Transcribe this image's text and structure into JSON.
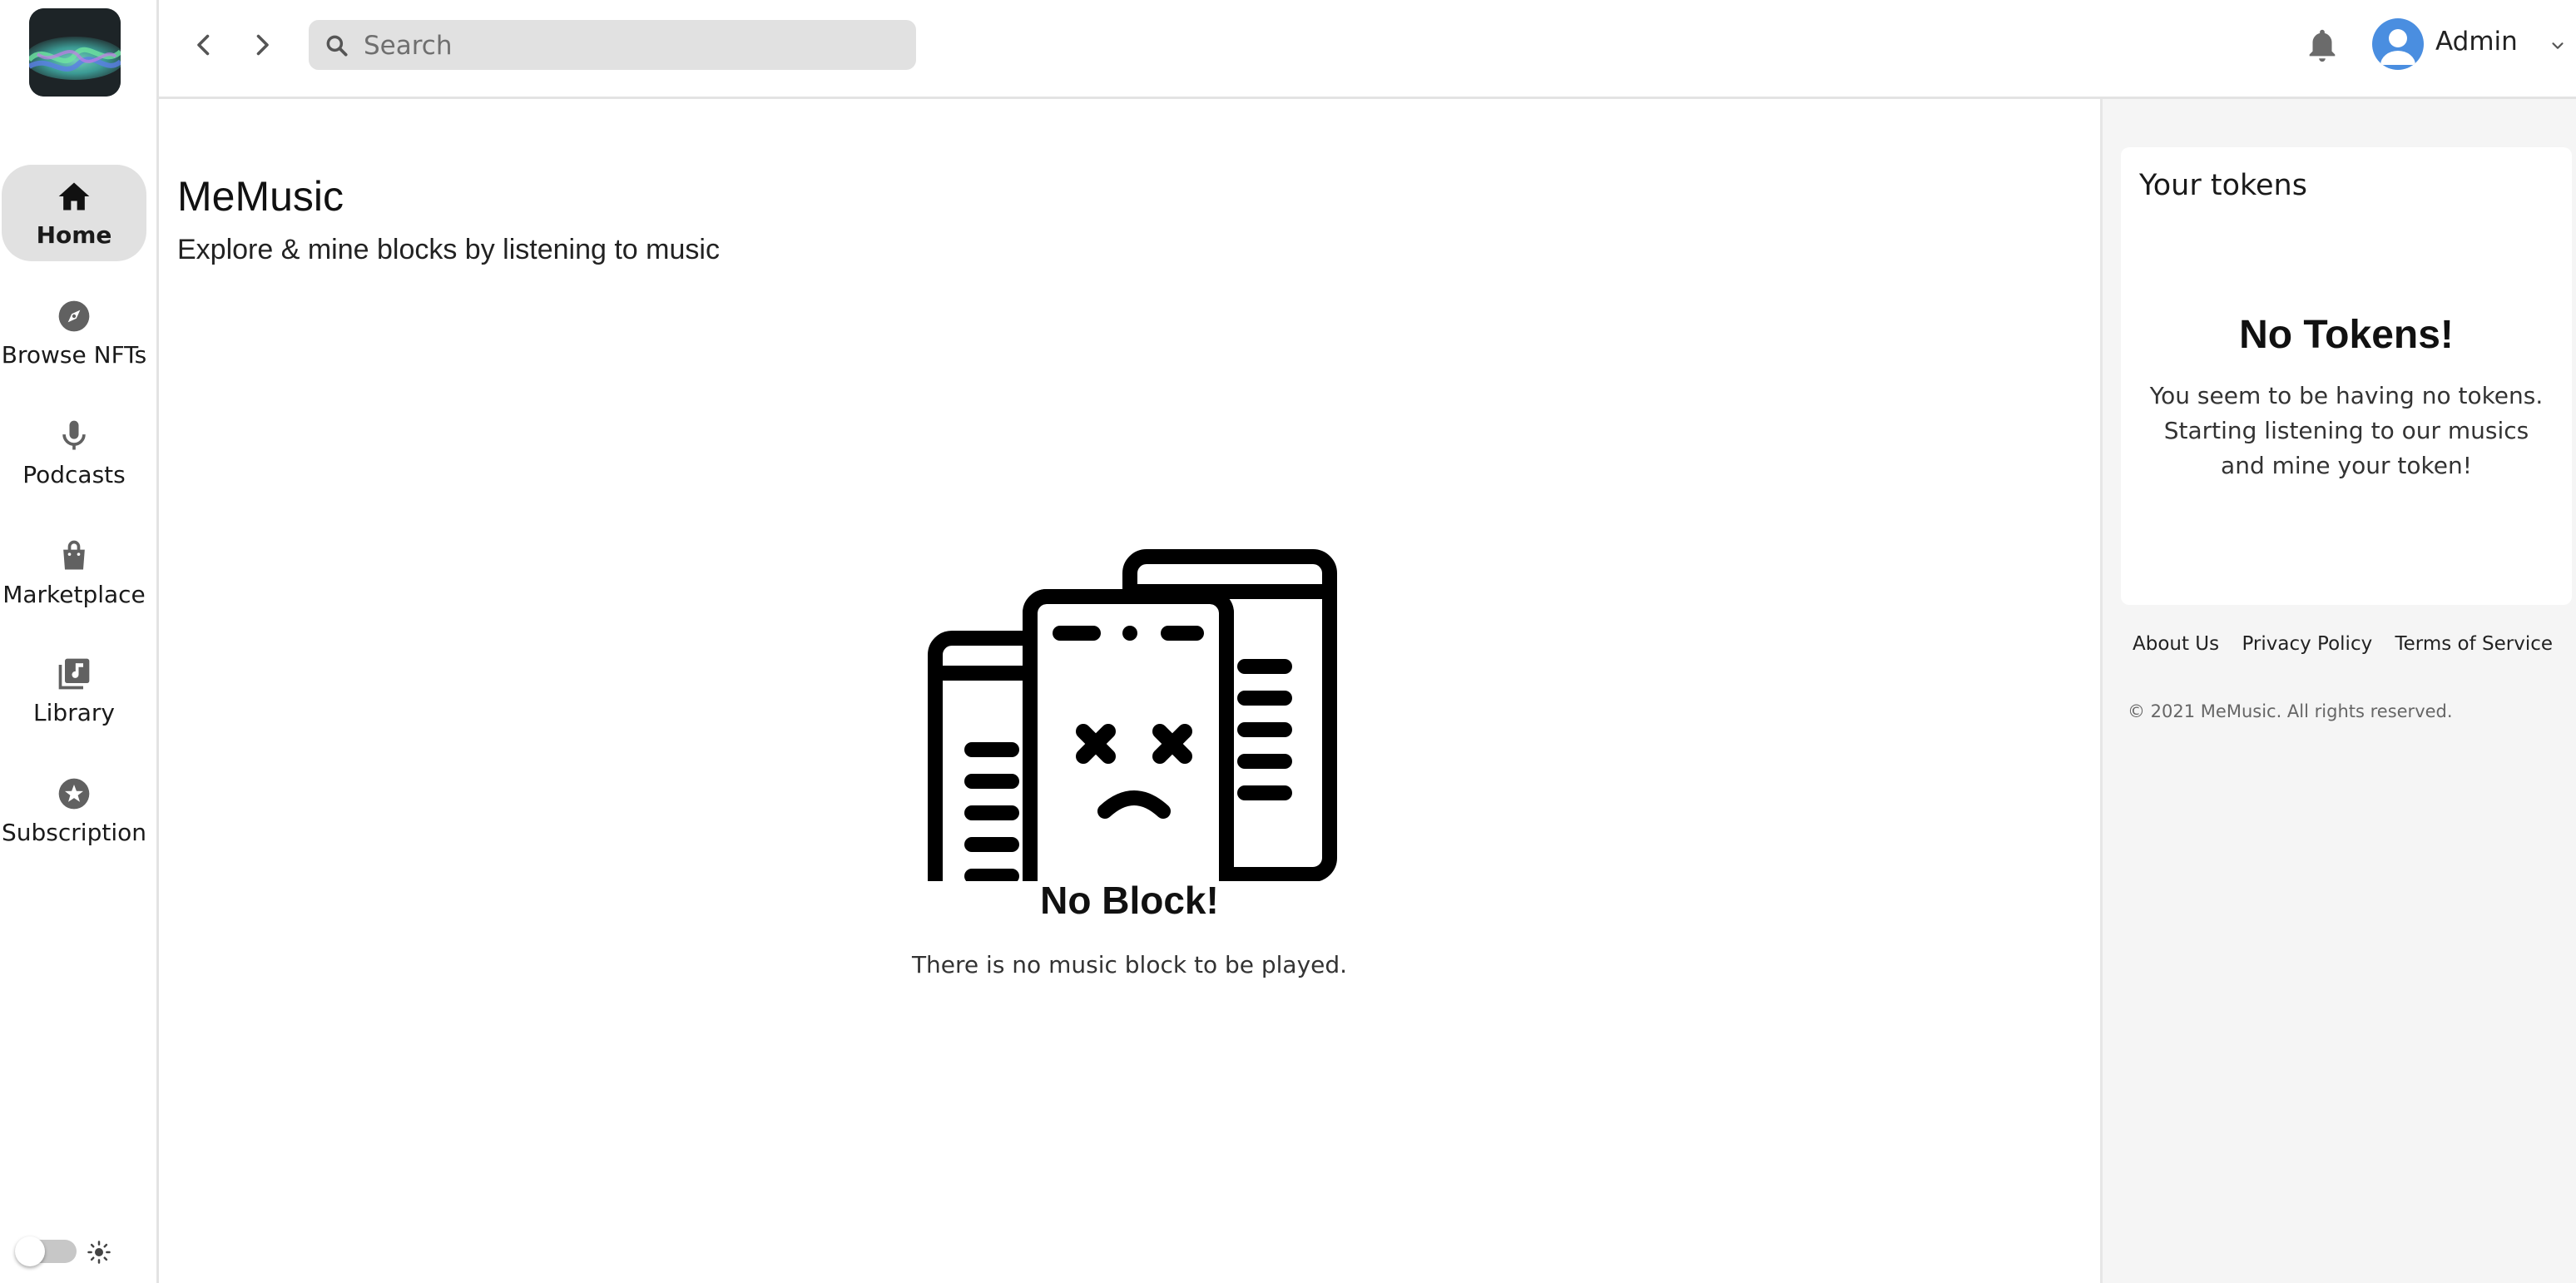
{
  "sidebar": {
    "items": [
      {
        "label": "Home",
        "icon": "home-icon",
        "active": true
      },
      {
        "label": "Browse NFTs",
        "icon": "compass-icon"
      },
      {
        "label": "Podcasts",
        "icon": "microphone-icon"
      },
      {
        "label": "Marketplace",
        "icon": "shopping-bag-icon"
      },
      {
        "label": "Library",
        "icon": "music-library-icon"
      },
      {
        "label": "Subscription",
        "icon": "star-icon"
      }
    ],
    "theme_toggle": {
      "state": "off",
      "icon": "sun-icon"
    }
  },
  "header": {
    "search": {
      "placeholder": "Search",
      "value": ""
    },
    "user": {
      "name": "Admin"
    }
  },
  "main": {
    "title": "MeMusic",
    "subtitle": "Explore & mine blocks by listening to music",
    "empty_title": "No Block!",
    "empty_text": "There is no music block to be played."
  },
  "tokens": {
    "title": "Your tokens",
    "empty_title": "No Tokens!",
    "empty_text": "You seem to be having no tokens. Starting listening to our musics and mine your token!"
  },
  "footer": {
    "links": [
      "About Us",
      "Privacy Policy",
      "Terms of Service"
    ],
    "copyright": "© 2021 MeMusic. All rights reserved."
  },
  "colors": {
    "accent_avatar": "#4a8ee0",
    "active_nav_bg": "#e1e1e1",
    "panel_bg": "#f5f5f5"
  }
}
